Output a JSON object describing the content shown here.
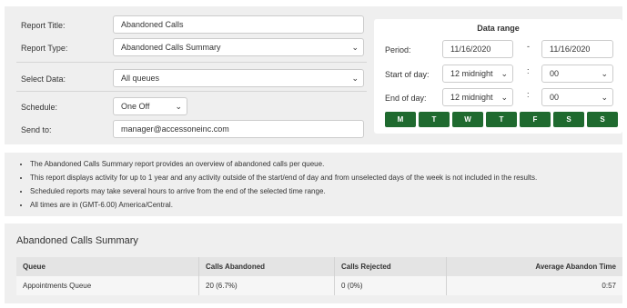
{
  "form": {
    "report_title_label": "Report Title:",
    "report_title_value": "Abandoned Calls",
    "report_type_label": "Report Type:",
    "report_type_value": "Abandoned Calls Summary",
    "select_data_label": "Select Data:",
    "select_data_value": "All queues",
    "schedule_label": "Schedule:",
    "schedule_value": "One Off",
    "send_to_label": "Send to:",
    "send_to_value": "manager@accessoneinc.com"
  },
  "range": {
    "title": "Data range",
    "period_label": "Period:",
    "period_from": "11/16/2020",
    "period_sep": "-",
    "period_to": "11/16/2020",
    "start_label": "Start of day:",
    "start_hour": "12 midnight",
    "start_sep": ":",
    "start_min": "00",
    "end_label": "End of day:",
    "end_hour": "12 midnight",
    "end_sep": ":",
    "end_min": "00",
    "days": [
      "M",
      "T",
      "W",
      "T",
      "F",
      "S",
      "S"
    ]
  },
  "notes": [
    "The Abandoned Calls Summary report provides an overview of abandoned calls per queue.",
    "This report displays activity for up to 1 year and any activity outside of the start/end of day and from unselected days of the week is not included in the results.",
    "Scheduled reports may take several hours to arrive from the end of the selected time range.",
    "All times are in (GMT-6.00) America/Central."
  ],
  "summary": {
    "title": "Abandoned Calls Summary",
    "columns": [
      "Queue",
      "Calls Abandoned",
      "Calls Rejected",
      "Average Abandon Time"
    ],
    "rows": [
      [
        "Appointments Queue",
        "20 (6.7%)",
        "0 (0%)",
        "0:57"
      ]
    ]
  },
  "colors": {
    "accent": "#1f6a2f",
    "panel": "#efefef"
  }
}
